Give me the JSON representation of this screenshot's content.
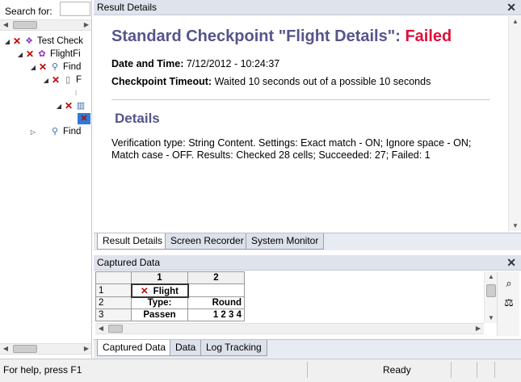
{
  "left_pane": {
    "search_label": "Search for:",
    "search_value": "",
    "tree": [
      {
        "label": "Test Check",
        "status": "failed",
        "icon": "test-icon"
      },
      {
        "label": "FlightFi",
        "status": "failed",
        "icon": "action-icon"
      },
      {
        "label": "Find",
        "status": "failed",
        "icon": "search-step-icon"
      },
      {
        "label": "F",
        "status": "failed",
        "icon": "document-icon"
      },
      {
        "label": "",
        "status": "none",
        "icon": "data-table-icon"
      },
      {
        "label": "",
        "status": "failed",
        "icon": "checkpoint-icon"
      },
      {
        "label": "",
        "status": "failed",
        "icon": "checkpoint-selected-icon"
      },
      {
        "label": "Find",
        "status": "none",
        "icon": "search-step-icon"
      }
    ]
  },
  "result_details": {
    "pane_title": "Result Details",
    "title_prefix": "Standard Checkpoint \"Flight Details\": ",
    "title_status": "Failed",
    "date_label": "Date and Time:",
    "date_value": "7/12/2012 - 10:24:37",
    "timeout_label": "Checkpoint Timeout:",
    "timeout_value": "Waited 10 seconds out of a possible 10 seconds",
    "details_heading": "Details",
    "details_text": "Verification type: String Content. Settings: Exact match - ON; Ignore space - ON; Match case - OFF. Results: Checked 28 cells; Succeeded: 27; Failed: 1",
    "tabs": [
      "Result Details",
      "Screen Recorder",
      "System Monitor"
    ]
  },
  "captured_data": {
    "pane_title": "Captured Data",
    "columns": [
      "1",
      "2"
    ],
    "rows": [
      {
        "num": "1",
        "c1": "Flight",
        "c2": "",
        "failed": true
      },
      {
        "num": "2",
        "c1": "Type:",
        "c2": "Round"
      },
      {
        "num": "3",
        "c1": "Passen",
        "c2": "1 2 3 4"
      }
    ],
    "tabs": [
      "Captured Data",
      "Data",
      "Log Tracking"
    ]
  },
  "status_bar": {
    "help_text": "For help, press F1",
    "ready_text": "Ready"
  },
  "colors": {
    "title": "#55558a",
    "failed": "#e0103a"
  }
}
